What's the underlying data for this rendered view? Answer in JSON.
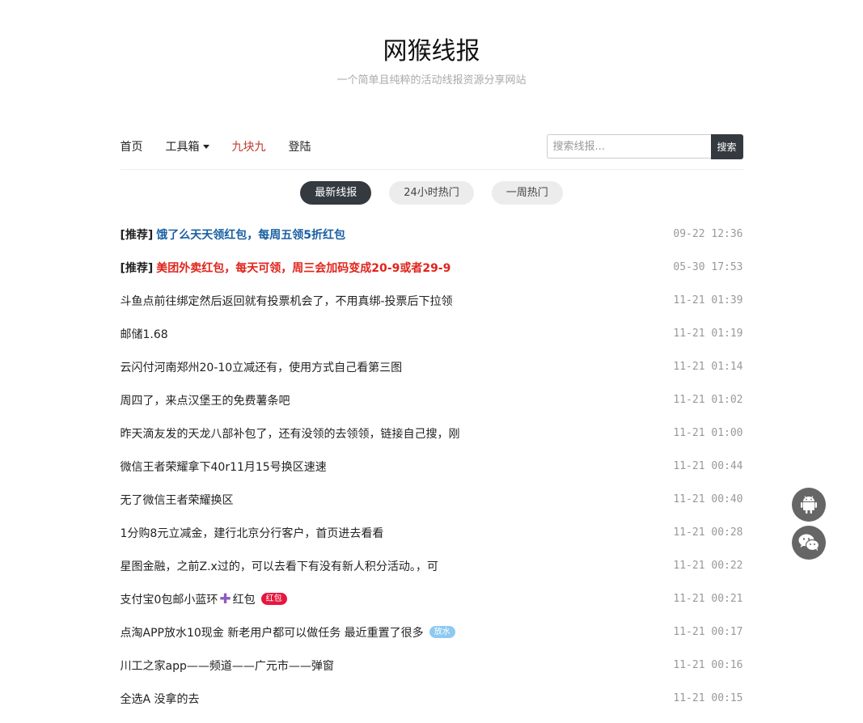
{
  "header": {
    "title": "网猴线报",
    "subtitle": "一个简单且纯粹的活动线报资源分享网站"
  },
  "nav": {
    "home": "首页",
    "toolbox": "工具箱",
    "nine": "九块九",
    "login": "登陆"
  },
  "search": {
    "placeholder": "搜索线报...",
    "button": "搜索"
  },
  "tabs": [
    "最新线报",
    "24小时热门",
    "一周热门"
  ],
  "posts": [
    {
      "tag": "[推荐]",
      "title": "饿了么天天领红包，每周五领5折红包",
      "time": "09-22 12:36"
    },
    {
      "tag": "[推荐]",
      "title": "美团外卖红包，每天可领，周三会加码变成20-9或者29-9",
      "time": "05-30 17:53"
    },
    {
      "title": "斗鱼点前往绑定然后返回就有投票机会了，不用真绑-投票后下拉领",
      "time": "11-21 01:39"
    },
    {
      "title": "邮储1.68",
      "time": "11-21 01:19"
    },
    {
      "title": "云闪付河南郑州20-10立减还有，使用方式自己看第三图",
      "time": "11-21 01:14"
    },
    {
      "title": "周四了，来点汉堡王的免费薯条吧",
      "time": "11-21 01:02"
    },
    {
      "title": "昨天滴友发的天龙八部补包了，还有没领的去领领，链接自己搜，刚",
      "time": "11-21 01:00"
    },
    {
      "title": "微信王者荣耀拿下40r11月15号换区速速",
      "time": "11-21 00:44"
    },
    {
      "title": "无了微信王者荣耀换区",
      "time": "11-21 00:40"
    },
    {
      "title": "1分购8元立减金，建行北京分行客户，首页进去看看",
      "time": "11-21 00:28"
    },
    {
      "title": "星图金融，之前Z.x过的，可以去看下有没有新人积分活动。，可",
      "time": "11-21 00:22"
    },
    {
      "title_a": "支付宝0包邮小蓝环",
      "title_b": "红包",
      "badge": "红包",
      "time": "11-21 00:21"
    },
    {
      "title": "点淘APP放水10现金 新老用户都可以做任务 最近重置了很多",
      "badge": "放水",
      "time": "11-21 00:17"
    },
    {
      "title": "川工之家app——频道——广元市——弹窗",
      "time": "11-21 00:16"
    },
    {
      "title": "全选A 没拿的去",
      "time": "11-21 00:15"
    }
  ]
}
